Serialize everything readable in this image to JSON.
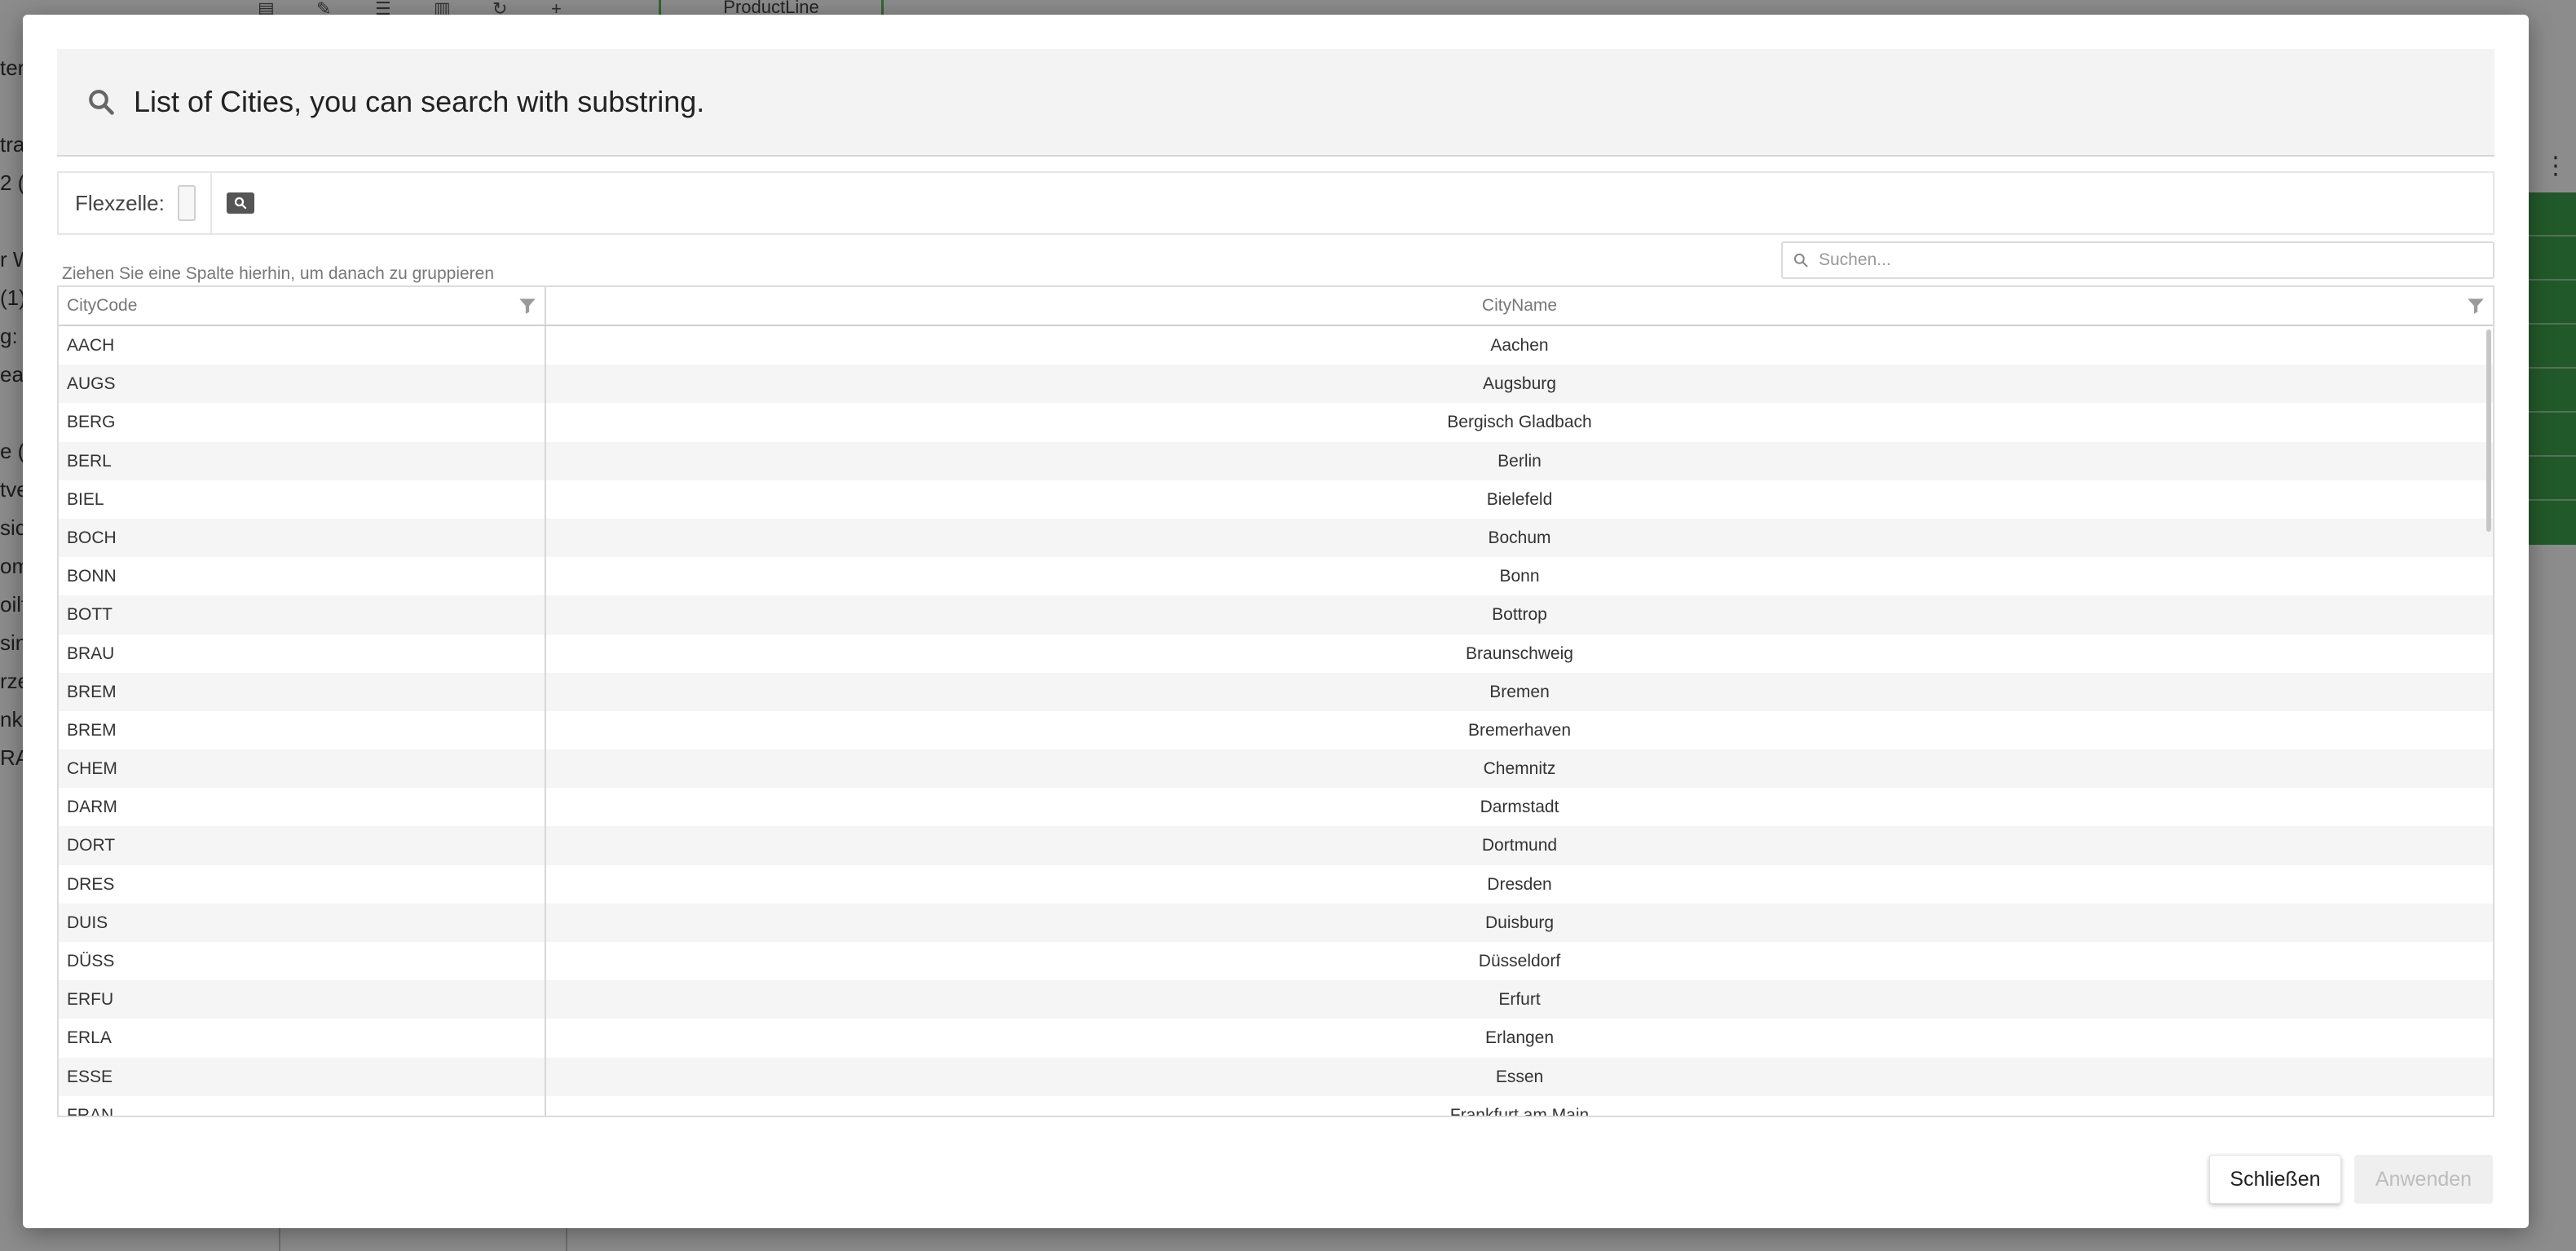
{
  "background": {
    "product_tab": "ProductLine",
    "left_fragments": [
      "ter",
      "",
      "tra",
      "2 (",
      "",
      "r W",
      "(1)",
      "g: `",
      "ear",
      "",
      "e (N",
      "tve",
      "sic",
      "om",
      "oilf",
      "sin",
      "rze",
      "nkc",
      "RA"
    ]
  },
  "modal": {
    "title": "List of Cities, you can search with substring.",
    "flex_label": "Flexzelle:",
    "group_hint": "Ziehen Sie eine Spalte hierhin, um danach zu gruppieren",
    "search_placeholder": "Suchen...",
    "columns": {
      "code": "CityCode",
      "name": "CityName"
    },
    "rows": [
      {
        "code": "AACH",
        "name": "Aachen"
      },
      {
        "code": "AUGS",
        "name": "Augsburg"
      },
      {
        "code": "BERG",
        "name": "Bergisch Gladbach"
      },
      {
        "code": "BERL",
        "name": "Berlin"
      },
      {
        "code": "BIEL",
        "name": "Bielefeld"
      },
      {
        "code": "BOCH",
        "name": "Bochum"
      },
      {
        "code": "BONN",
        "name": "Bonn"
      },
      {
        "code": "BOTT",
        "name": "Bottrop"
      },
      {
        "code": "BRAU",
        "name": "Braunschweig"
      },
      {
        "code": "BREM",
        "name": "Bremen"
      },
      {
        "code": "BREM",
        "name": "Bremerhaven"
      },
      {
        "code": "CHEM",
        "name": "Chemnitz"
      },
      {
        "code": "DARM",
        "name": "Darmstadt"
      },
      {
        "code": "DORT",
        "name": "Dortmund"
      },
      {
        "code": "DRES",
        "name": "Dresden"
      },
      {
        "code": "DUIS",
        "name": "Duisburg"
      },
      {
        "code": "DÜSS",
        "name": "Düsseldorf"
      },
      {
        "code": "ERFU",
        "name": "Erfurt"
      },
      {
        "code": "ERLA",
        "name": "Erlangen"
      },
      {
        "code": "ESSE",
        "name": "Essen"
      },
      {
        "code": "FRAN",
        "name": "Frankfurt am Main"
      }
    ],
    "close_label": "Schließen",
    "apply_label": "Anwenden"
  }
}
